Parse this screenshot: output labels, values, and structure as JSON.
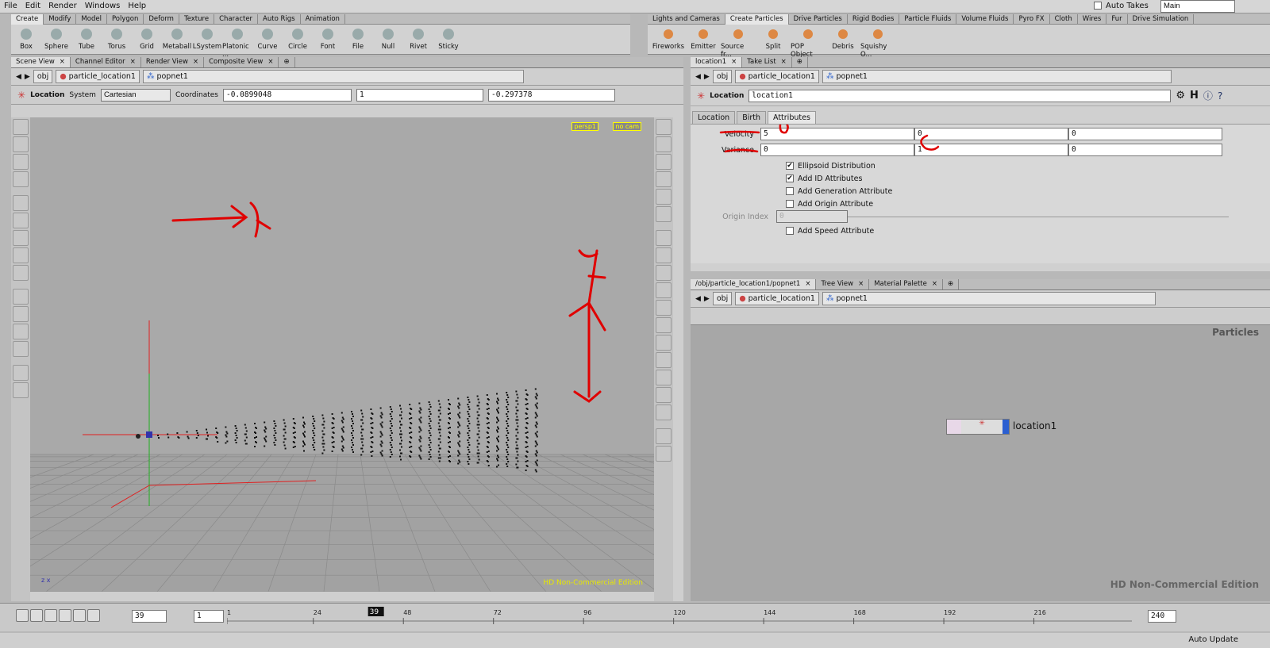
{
  "menu": [
    "File",
    "Edit",
    "Render",
    "Windows",
    "Help"
  ],
  "auto_takes": "Auto Takes",
  "desktop": "Main",
  "shelf_left": {
    "tabs": [
      "Create",
      "Modify",
      "Model",
      "Polygon",
      "Deform",
      "Texture",
      "Character",
      "Auto Rigs",
      "Animation"
    ],
    "tools": [
      "Box",
      "Sphere",
      "Tube",
      "Torus",
      "Grid",
      "Metaball",
      "LSystem",
      "Platonic ...",
      "Curve",
      "Circle",
      "Font",
      "File",
      "Null",
      "Rivet",
      "Sticky"
    ]
  },
  "shelf_right": {
    "tabs": [
      "Lights and Cameras",
      "Create Particles",
      "Drive Particles",
      "Rigid Bodies",
      "Particle Fluids",
      "Volume Fluids",
      "Pyro FX",
      "Cloth",
      "Wires",
      "Fur",
      "Drive Simulation"
    ],
    "tools": [
      "Fireworks",
      "Emitter",
      "Source fr...",
      "Split",
      "POP Object",
      "Debris",
      "Squishy O..."
    ]
  },
  "left_tabs": [
    "Scene View",
    "Channel Editor",
    "Render View",
    "Composite View"
  ],
  "path": {
    "obj": "obj",
    "node": "particle_location1",
    "net": "popnet1"
  },
  "handle": {
    "label": "Location",
    "system_label": "System",
    "system": "Cartesian",
    "coords_label": "Coordinates",
    "x": "-0.0899048",
    "y": "1",
    "z": "-0.297378"
  },
  "viewport": {
    "cam": "persp1",
    "nocam": "no cam",
    "watermark": "HD Non-Commercial Edition"
  },
  "param_tabs": [
    "location1",
    "Take List"
  ],
  "params": {
    "type_label": "Location",
    "name": "location1",
    "subtabs": [
      "Location",
      "Birth",
      "Attributes"
    ],
    "velocity_label": "Velocity",
    "velocity": [
      "5",
      "0",
      "0"
    ],
    "variance_label": "Variance",
    "variance": [
      "0",
      "1",
      "0"
    ],
    "checks": [
      {
        "label": "Ellipsoid Distribution",
        "on": true
      },
      {
        "label": "Add ID Attributes",
        "on": true
      },
      {
        "label": "Add Generation Attribute",
        "on": false
      },
      {
        "label": "Add Origin Attribute",
        "on": false
      }
    ],
    "origin_index_label": "Origin Index",
    "origin_index": "0",
    "speed": "Add Speed Attribute"
  },
  "network_tabs": [
    "/obj/particle_location1/popnet1",
    "Tree View",
    "Material Palette"
  ],
  "network": {
    "context": "Particles",
    "node": "location1",
    "watermark": "HD Non-Commercial Edition"
  },
  "timeline": {
    "frame": "39",
    "start": "1",
    "end": "240",
    "current": "39",
    "ticks": [
      "1",
      "24",
      "48",
      "72",
      "96",
      "120",
      "144",
      "168",
      "192",
      "216"
    ]
  },
  "status": {
    "update": "Auto Update"
  },
  "colors": {
    "annotation": "#e00000",
    "viewport_bg": "#a9a9a9",
    "grid": "#8a8a8a"
  }
}
